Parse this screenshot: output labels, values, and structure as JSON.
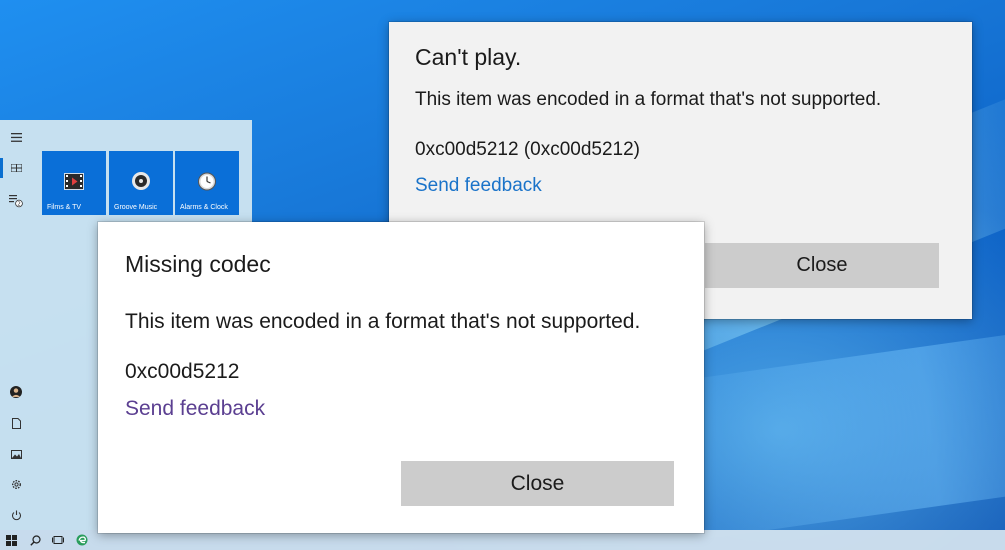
{
  "start_menu": {
    "tiles": [
      {
        "label": "Films & TV",
        "icon": "film-icon"
      },
      {
        "label": "Groove Music",
        "icon": "music-disc-icon"
      },
      {
        "label": "Alarms & Clock",
        "icon": "alarm-clock-icon"
      }
    ],
    "rail_icons": [
      "hamburger-menu-icon",
      "all-apps-icon",
      "list-icon",
      "user-avatar-icon",
      "documents-icon",
      "pictures-icon",
      "settings-icon",
      "power-icon"
    ],
    "list_badge": "2"
  },
  "taskbar": {
    "icons": [
      "windows-start-icon",
      "search-icon",
      "task-view-icon",
      "edge-icon"
    ]
  },
  "dialogs": {
    "back": {
      "title": "Can't play.",
      "message": "This item was encoded in a format that's not supported.",
      "error_code": "0xc00d5212 (0xc00d5212)",
      "feedback_link": "Send feedback",
      "close_label": "Close"
    },
    "front": {
      "title": "Missing codec",
      "message": "This item was encoded in a format that's not supported.",
      "error_code": "0xc00d5212",
      "feedback_link": "Send feedback",
      "close_label": "Close"
    }
  },
  "colors": {
    "desktop": "#1878d8",
    "tile": "#0a6fd8",
    "link_blue": "#1a73c9",
    "link_purple": "#5b3f91",
    "button": "#cccccc"
  }
}
